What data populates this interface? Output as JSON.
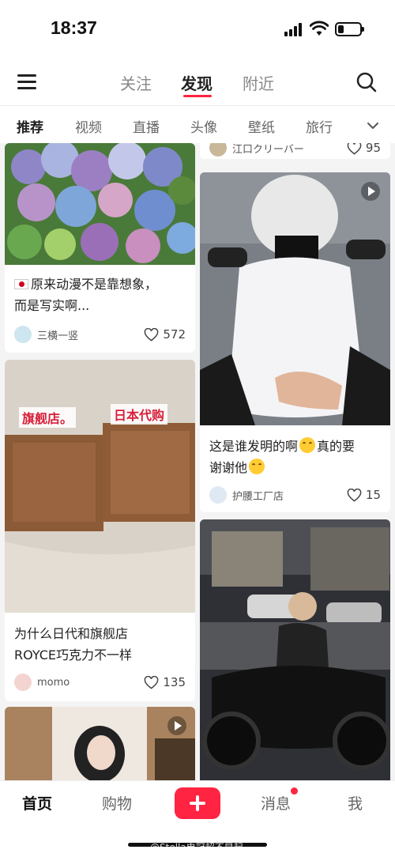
{
  "status_bar": {
    "time": "18:37"
  },
  "header": {
    "tabs": [
      {
        "label": "关注"
      },
      {
        "label": "发现"
      },
      {
        "label": "附近"
      }
    ]
  },
  "categories": [
    "推荐",
    "视频",
    "直播",
    "头像",
    "壁纸",
    "旅行"
  ],
  "feed": {
    "top_partial": {
      "author": "江口クリーバー",
      "likes": "95"
    },
    "cards": [
      {
        "flag_icon": "japan-flag-icon",
        "title_line1": "原来动漫不是靠想象，",
        "title_line2": "而是写实啊...",
        "author": "三横一竖",
        "likes": "572"
      },
      {
        "title_prefix": "这是谁发明的啊",
        "emoji1": "grin-emoji-icon",
        "title_suffix": "真的要",
        "title_line2": "谢谢他",
        "emoji2": "upside-down-emoji-icon",
        "author": "护腰工厂店",
        "likes": "15",
        "has_video": true
      },
      {
        "sticker_left": "旗舰店。",
        "sticker_right": "日本代购",
        "title_line1": "为什么日代和旗舰店",
        "title_line2": "ROYCE巧克力不一样",
        "author": "momo",
        "likes": "135"
      },
      {
        "has_video": true
      },
      {}
    ]
  },
  "tabbar": {
    "home": "首页",
    "shop": "购物",
    "messages": "消息",
    "me": "我"
  },
  "watermark": "@Stella电冠超不早起",
  "colors": {
    "accent": "#ff2442"
  }
}
